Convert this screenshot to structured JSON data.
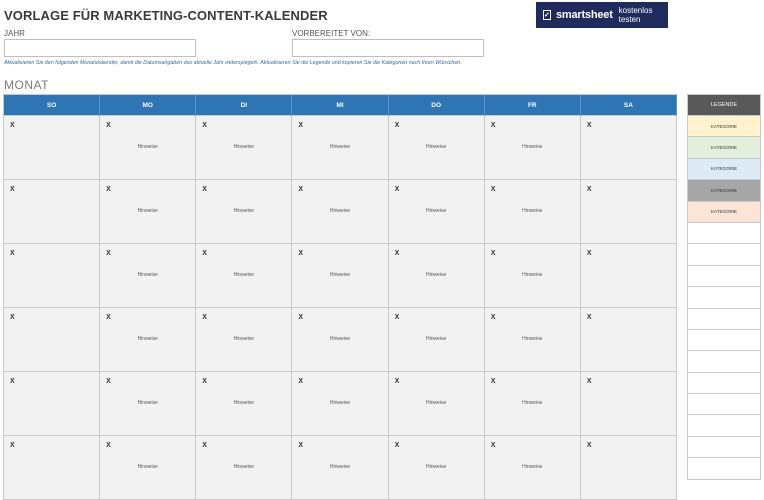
{
  "header": {
    "title": "VORLAGE FÜR MARKETING-CONTENT-KALENDER",
    "banner": {
      "brand": "smartsheet",
      "cta": "kostenlos testen",
      "logo_glyph": "✓",
      "background": "#1f2b5c"
    }
  },
  "fields": {
    "year_label": "JAHR",
    "prepared_by_label": "VORBEREITET VON:"
  },
  "instructions": "Aktualisieren Sie den folgenden Monatskalender, damit die Datumsangaben das aktuelle Jahr widerspiegeln. Aktualisieren Sie die Legende und kopieren Sie die Kategorien nach Ihren Wünschen.",
  "month_label": "MONAT",
  "calendar": {
    "header_color": "#2e75b6",
    "days": [
      "SO",
      "MO",
      "DI",
      "MI",
      "DO",
      "FR",
      "SA"
    ],
    "cell_mark": "X",
    "note_label": "Hinweise",
    "weeks": 6
  },
  "legend": {
    "title": "LEGENDE",
    "items": [
      {
        "label": "KATEGORIE",
        "color": "#fff2cc"
      },
      {
        "label": "KATEGORIE",
        "color": "#e2efda"
      },
      {
        "label": "KATEGORIE",
        "color": "#ddebf7"
      },
      {
        "label": "KATEGORIE",
        "color": "#a6a6a6"
      },
      {
        "label": "KATEGORIE",
        "color": "#fce4d6"
      },
      {
        "label": "",
        "color": "#ffffff"
      },
      {
        "label": "",
        "color": "#ffffff"
      },
      {
        "label": "",
        "color": "#ffffff"
      },
      {
        "label": "",
        "color": "#ffffff"
      },
      {
        "label": "",
        "color": "#ffffff"
      },
      {
        "label": "",
        "color": "#ffffff"
      },
      {
        "label": "",
        "color": "#ffffff"
      },
      {
        "label": "",
        "color": "#ffffff"
      },
      {
        "label": "",
        "color": "#ffffff"
      },
      {
        "label": "",
        "color": "#ffffff"
      },
      {
        "label": "",
        "color": "#ffffff"
      },
      {
        "label": "",
        "color": "#ffffff"
      }
    ]
  }
}
